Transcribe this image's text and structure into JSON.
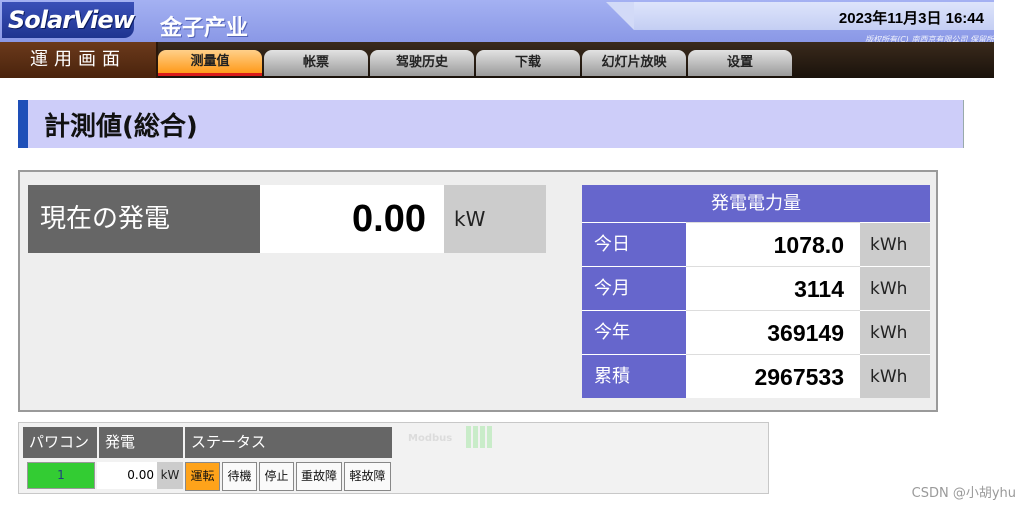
{
  "header": {
    "logo": "SolarView",
    "company": "金子产业",
    "datetime": "2023年11月3日 16:44",
    "copyright": "版权所有(C) 南西京有限公司 保留所有权利"
  },
  "nav": {
    "section_label": "運用画面",
    "tabs": [
      {
        "label": "测量值",
        "active": true
      },
      {
        "label": "帐票",
        "active": false
      },
      {
        "label": "驾驶历史",
        "active": false
      },
      {
        "label": "下载",
        "active": false
      },
      {
        "label": "幻灯片放映",
        "active": false
      },
      {
        "label": "设置",
        "active": false
      }
    ]
  },
  "page": {
    "title": "計測値(総合)"
  },
  "current": {
    "label": "現在の発電",
    "value": "0.00",
    "unit": "kW"
  },
  "energy": {
    "header": "発電電力量",
    "rows": [
      {
        "label": "今日",
        "value": "1078.0",
        "unit": "kWh"
      },
      {
        "label": "今月",
        "value": "3114",
        "unit": "kWh"
      },
      {
        "label": "今年",
        "value": "369149",
        "unit": "kWh"
      },
      {
        "label": "累積",
        "value": "2967533",
        "unit": "kWh"
      }
    ]
  },
  "inverters": {
    "headers": {
      "pcs": "パワコン",
      "gen": "発電",
      "status": "ステータス"
    },
    "row": {
      "id": "1",
      "value": "0.00",
      "unit": "kW",
      "statuses": [
        {
          "label": "運転",
          "active": true
        },
        {
          "label": "待機",
          "active": false
        },
        {
          "label": "停止",
          "active": false
        },
        {
          "label": "重故障",
          "active": false
        },
        {
          "label": "軽故障",
          "active": false
        }
      ]
    },
    "modbus_label": "Modbus"
  },
  "watermark": "CSDN @小胡yhu",
  "colors": {
    "header_blue": "#8a98e6",
    "active_tab": "#ff9a1a",
    "energy_blue": "#6666cc",
    "status_on": "#ffa31a",
    "pcs_green": "#33cc33"
  }
}
